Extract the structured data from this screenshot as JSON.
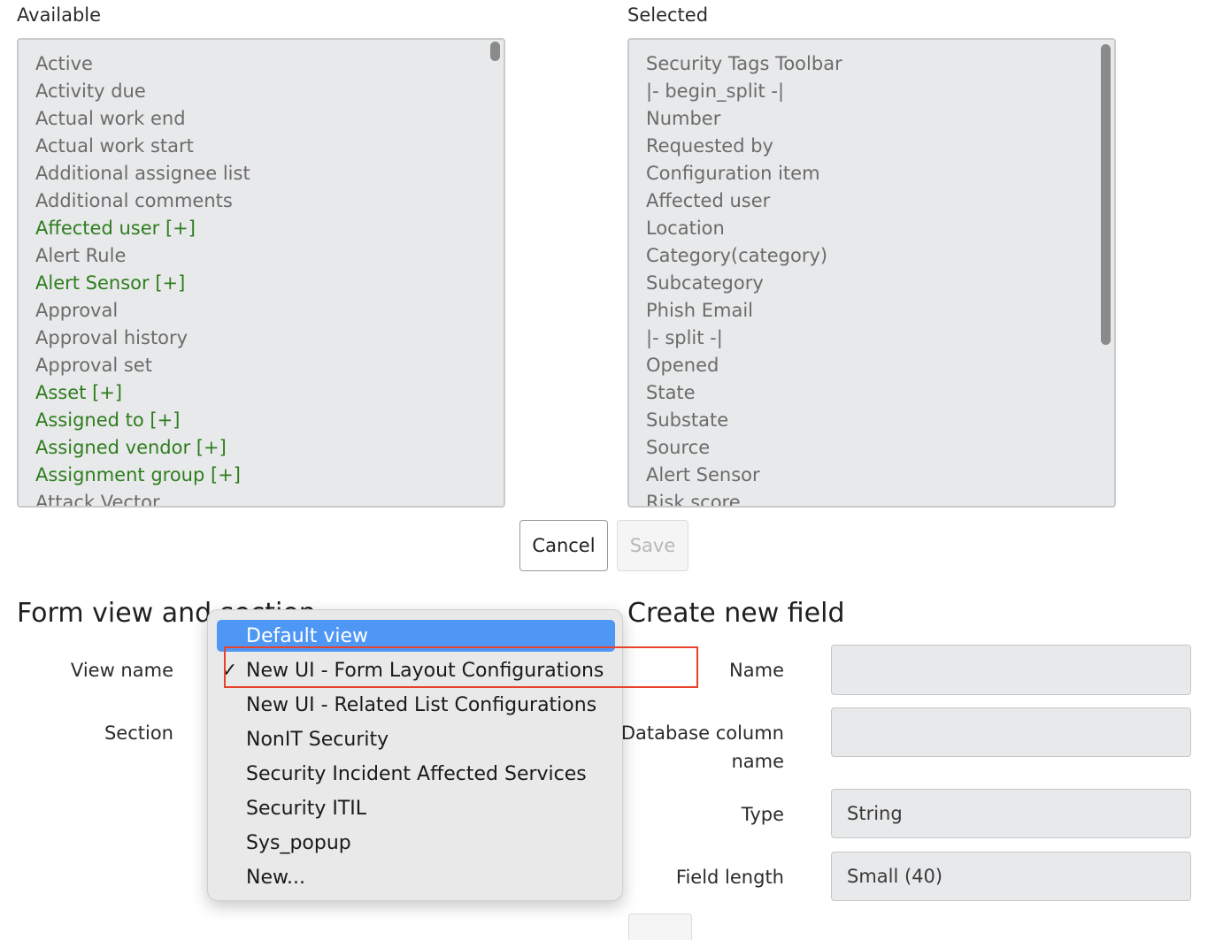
{
  "available": {
    "label": "Available",
    "items": [
      {
        "text": "Active",
        "ref": false
      },
      {
        "text": "Activity due",
        "ref": false
      },
      {
        "text": "Actual work end",
        "ref": false
      },
      {
        "text": "Actual work start",
        "ref": false
      },
      {
        "text": "Additional assignee list",
        "ref": false
      },
      {
        "text": "Additional comments",
        "ref": false
      },
      {
        "text": "Affected user [+]",
        "ref": true
      },
      {
        "text": "Alert Rule",
        "ref": false
      },
      {
        "text": "Alert Sensor [+]",
        "ref": true
      },
      {
        "text": "Approval",
        "ref": false
      },
      {
        "text": "Approval history",
        "ref": false
      },
      {
        "text": "Approval set",
        "ref": false
      },
      {
        "text": "Asset [+]",
        "ref": true
      },
      {
        "text": "Assigned to [+]",
        "ref": true
      },
      {
        "text": "Assigned vendor [+]",
        "ref": true
      },
      {
        "text": "Assignment group [+]",
        "ref": true
      },
      {
        "text": "Attack Vector",
        "ref": false
      }
    ]
  },
  "selected": {
    "label": "Selected",
    "items": [
      {
        "text": "Security Tags Toolbar"
      },
      {
        "text": "|- begin_split -|"
      },
      {
        "text": "Number"
      },
      {
        "text": "Requested by"
      },
      {
        "text": "Configuration item"
      },
      {
        "text": "Affected user"
      },
      {
        "text": "Location"
      },
      {
        "text": "Category(category)"
      },
      {
        "text": "Subcategory"
      },
      {
        "text": "Phish Email"
      },
      {
        "text": "|- split -|"
      },
      {
        "text": "Opened"
      },
      {
        "text": "State"
      },
      {
        "text": "Substate"
      },
      {
        "text": "Source"
      },
      {
        "text": "Alert Sensor"
      },
      {
        "text": "Risk score"
      }
    ]
  },
  "actions": {
    "cancel_label": "Cancel",
    "save_label": "Save"
  },
  "form_view": {
    "title": "Form view and section",
    "view_name_label": "View name",
    "section_label": "Section"
  },
  "dropdown": {
    "options": [
      {
        "text": "Default view",
        "highlighted": true,
        "checked": false
      },
      {
        "text": "New UI - Form Layout Configurations",
        "highlighted": false,
        "checked": true
      },
      {
        "text": "New UI - Related List Configurations",
        "highlighted": false,
        "checked": false
      },
      {
        "text": "NonIT Security",
        "highlighted": false,
        "checked": false
      },
      {
        "text": "Security Incident Affected Services",
        "highlighted": false,
        "checked": false
      },
      {
        "text": "Security ITIL",
        "highlighted": false,
        "checked": false
      },
      {
        "text": "Sys_popup",
        "highlighted": false,
        "checked": false
      },
      {
        "text": "New...",
        "highlighted": false,
        "checked": false
      }
    ],
    "check_glyph": "✓"
  },
  "create_field": {
    "title": "Create new field",
    "name_label": "Name",
    "name_value": "",
    "db_column_label_line1": "Database column",
    "db_column_label_line2": "name",
    "db_column_value": "",
    "type_label": "Type",
    "type_value": "String",
    "length_label": "Field length",
    "length_value": "Small (40)"
  },
  "colors": {
    "reference_field": "#2e7d1f",
    "highlight": "#4f97f5",
    "annotation_box": "#e8412c"
  }
}
